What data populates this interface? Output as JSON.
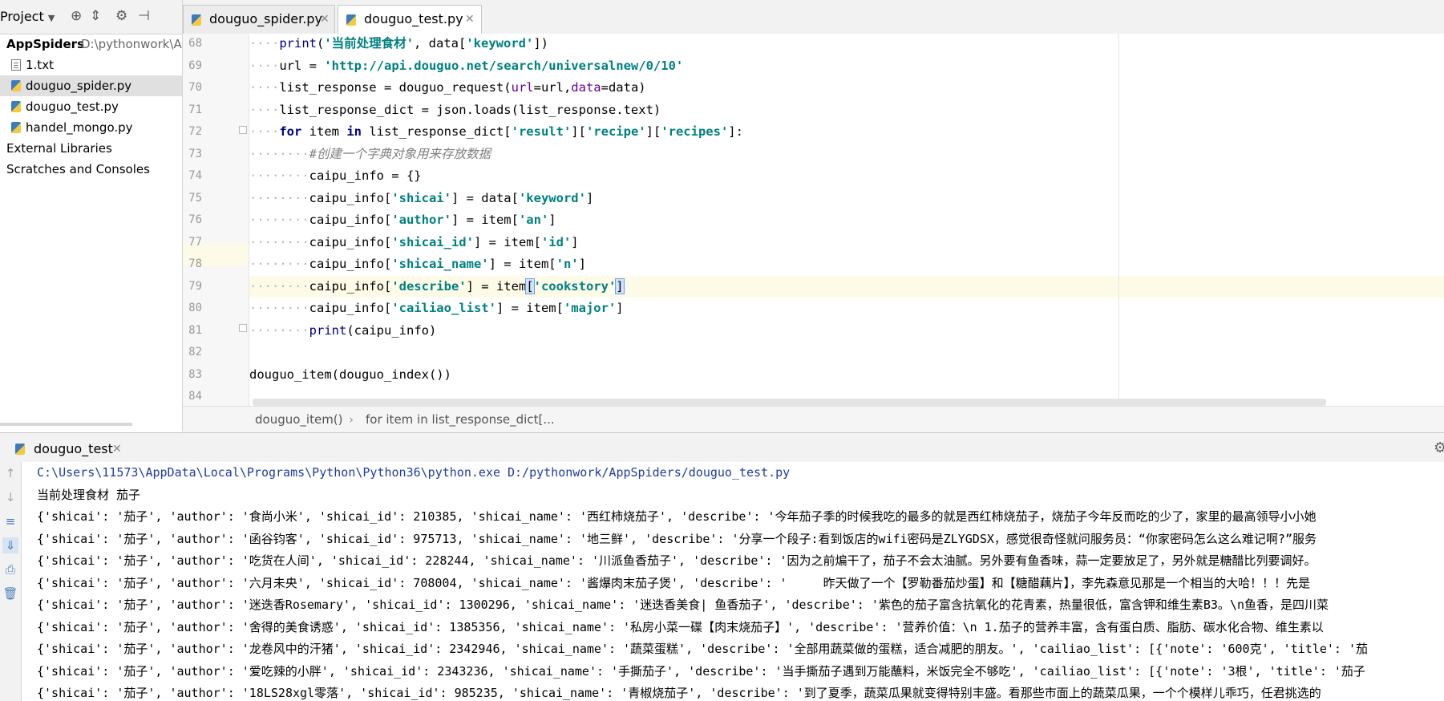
{
  "project_panel": {
    "title": "Project",
    "root": {
      "name": "AppSpiders",
      "path": "D:\\pythonwork\\A"
    },
    "items": [
      {
        "label": "1.txt",
        "type": "txt",
        "selected": false
      },
      {
        "label": "douguo_spider.py",
        "type": "py",
        "selected": true
      },
      {
        "label": "douguo_test.py",
        "type": "py",
        "selected": false
      },
      {
        "label": "handel_mongo.py",
        "type": "py",
        "selected": false
      }
    ],
    "external_libraries": "External Libraries",
    "scratches": "Scratches and Consoles"
  },
  "editor": {
    "tabs": [
      {
        "label": "douguo_spider.py",
        "active": false
      },
      {
        "label": "douguo_test.py",
        "active": true
      }
    ],
    "line_numbers": [
      "68",
      "69",
      "70",
      "71",
      "72",
      "73",
      "74",
      "75",
      "76",
      "77",
      "78",
      "79",
      "80",
      "81",
      "82",
      "83",
      "84"
    ],
    "current_line": "79",
    "breadcrumb": [
      "douguo_item()",
      "for item in list_response_dict[..."
    ]
  },
  "run_panel": {
    "tab": "douguo_test",
    "console_lines": [
      "C:\\Users\\11573\\AppData\\Local\\Programs\\Python\\Python36\\python.exe D:/pythonwork/AppSpiders/douguo_test.py",
      "当前处理食材 茄子",
      "{'shicai': '茄子', 'author': '食尚小米', 'shicai_id': 210385, 'shicai_name': '西红柿烧茄子', 'describe': '今年茄子季的时候我吃的最多的就是西红柿烧茄子，烧茄子今年反而吃的少了，家里的最高领导小小她",
      "{'shicai': '茄子', 'author': '函谷钧客', 'shicai_id': 975713, 'shicai_name': '地三鲜', 'describe': '分享一个段子:看到饭店的wifi密码是ZLYGDSX，感觉很奇怪就问服务员：“你家密码怎么这么难记啊?”服务",
      "{'shicai': '茄子', 'author': '吃货在人间', 'shicai_id': 228244, 'shicai_name': '川派鱼香茄子', 'describe': '因为之前煸干了，茄子不会太油腻。另外要有鱼香味，蒜一定要放足了，另外就是糖醋比列要调好。",
      "{'shicai': '茄子', 'author': '六月未央', 'shicai_id': 708004, 'shicai_name': '酱爆肉末茄子煲', 'describe': '     昨天做了一个【罗勒番茄炒蛋】和【糖醋藕片】，李先森意见那是一个相当的大哈！！！先是",
      "{'shicai': '茄子', 'author': '迷迭香Rosemary', 'shicai_id': 1300296, 'shicai_name': '迷迭香美食| 鱼香茄子', 'describe': '紫色的茄子富含抗氧化的花青素，热量很低，富含钾和维生素B3。\\n鱼香，是四川菜",
      "{'shicai': '茄子', 'author': '舍得的美食诱惑', 'shicai_id': 1385356, 'shicai_name': '私房小菜一碟【肉末烧茄子】', 'describe': '营养价值：\\n 1.茄子的营养丰富，含有蛋白质、脂肪、碳水化合物、维生素以",
      "{'shicai': '茄子', 'author': '龙卷风中的汗猪', 'shicai_id': 2342946, 'shicai_name': '蔬菜蛋糕', 'describe': '全部用蔬菜做的蛋糕，适合减肥的朋友。', 'cailiao_list': [{'note': '600克', 'title': '茄",
      "{'shicai': '茄子', 'author': '爱吃辣的小胖', 'shicai_id': 2343236, 'shicai_name': '手撕茄子', 'describe': '当手撕茄子遇到万能蘸料，米饭完全不够吃', 'cailiao_list': [{'note': '3根', 'title': '茄子",
      "{'shicai': '茄子', 'author': '18LS28xgl零落', 'shicai_id': 985235, 'shicai_name': '青椒烧茄子', 'describe': '到了夏季，蔬菜瓜果就变得特别丰盛。看那些市面上的蔬菜瓜果，一个个模样儿乖巧，任君挑选的"
    ]
  },
  "code": {
    "l68": {
      "ind": "····",
      "fn": "print",
      "p1": "(",
      "s1": "'当前处理食材'",
      "p2": ", data[",
      "s2": "'keyword'",
      "p3": "])"
    },
    "l69": {
      "ind": "····",
      "t1": "url = ",
      "s1": "'http://api.douguo.net/search/universalnew/0/10'"
    },
    "l70": {
      "ind": "····",
      "t1": "list_response = douguo_request(",
      "k1": "url",
      "t2": "=url,",
      "k2": "data",
      "t3": "=data)"
    },
    "l71": {
      "ind": "····",
      "t1": "list_response_dict = json.loads(list_response.text)"
    },
    "l72": {
      "ind": "····",
      "kw1": "for",
      "t1": " item ",
      "kw2": "in",
      "t2": " list_response_dict[",
      "s1": "'result'",
      "t3": "][",
      "s2": "'recipe'",
      "t4": "][",
      "s3": "'recipes'",
      "t5": "]:"
    },
    "l73": {
      "ind": "········",
      "c1": "#创建一个字典对象用来存放数据"
    },
    "l74": {
      "ind": "········",
      "t1": "caipu_info = {}"
    },
    "l75": {
      "ind": "········",
      "t1": "caipu_info[",
      "s1": "'shicai'",
      "t2": "] = data[",
      "s2": "'keyword'",
      "t3": "]"
    },
    "l76": {
      "ind": "········",
      "t1": "caipu_info[",
      "s1": "'author'",
      "t2": "] = item[",
      "s2": "'an'",
      "t3": "]"
    },
    "l77": {
      "ind": "········",
      "t1": "caipu_info[",
      "s1": "'shicai_id'",
      "t2": "] = item[",
      "s2": "'id'",
      "t3": "]"
    },
    "l78": {
      "ind": "········",
      "t1": "caipu_info[",
      "s1": "'shicai_name'",
      "t2": "] = item[",
      "s2": "'n'",
      "t3": "]"
    },
    "l79": {
      "ind": "········",
      "t1": "caipu_info[",
      "s1": "'describe'",
      "t2": "] = item",
      "b1": "[",
      "s2": "'cookstory'",
      "b2": "]"
    },
    "l80": {
      "ind": "········",
      "t1": "caipu_info[",
      "s1": "'cailiao_list'",
      "t2": "] = item[",
      "s2": "'major'",
      "t3": "]"
    },
    "l81": {
      "ind": "········",
      "fn": "print",
      "t1": "(caipu_info)"
    },
    "l82": {
      "t1": ""
    },
    "l83": {
      "t1": "douguo_item(douguo_index())"
    },
    "l84": {
      "t1": ""
    }
  },
  "icons": {
    "settings": "gear-icon",
    "collapse": "collapse-all-icon",
    "locate": "locate-icon",
    "hide": "hide-panel-icon"
  }
}
